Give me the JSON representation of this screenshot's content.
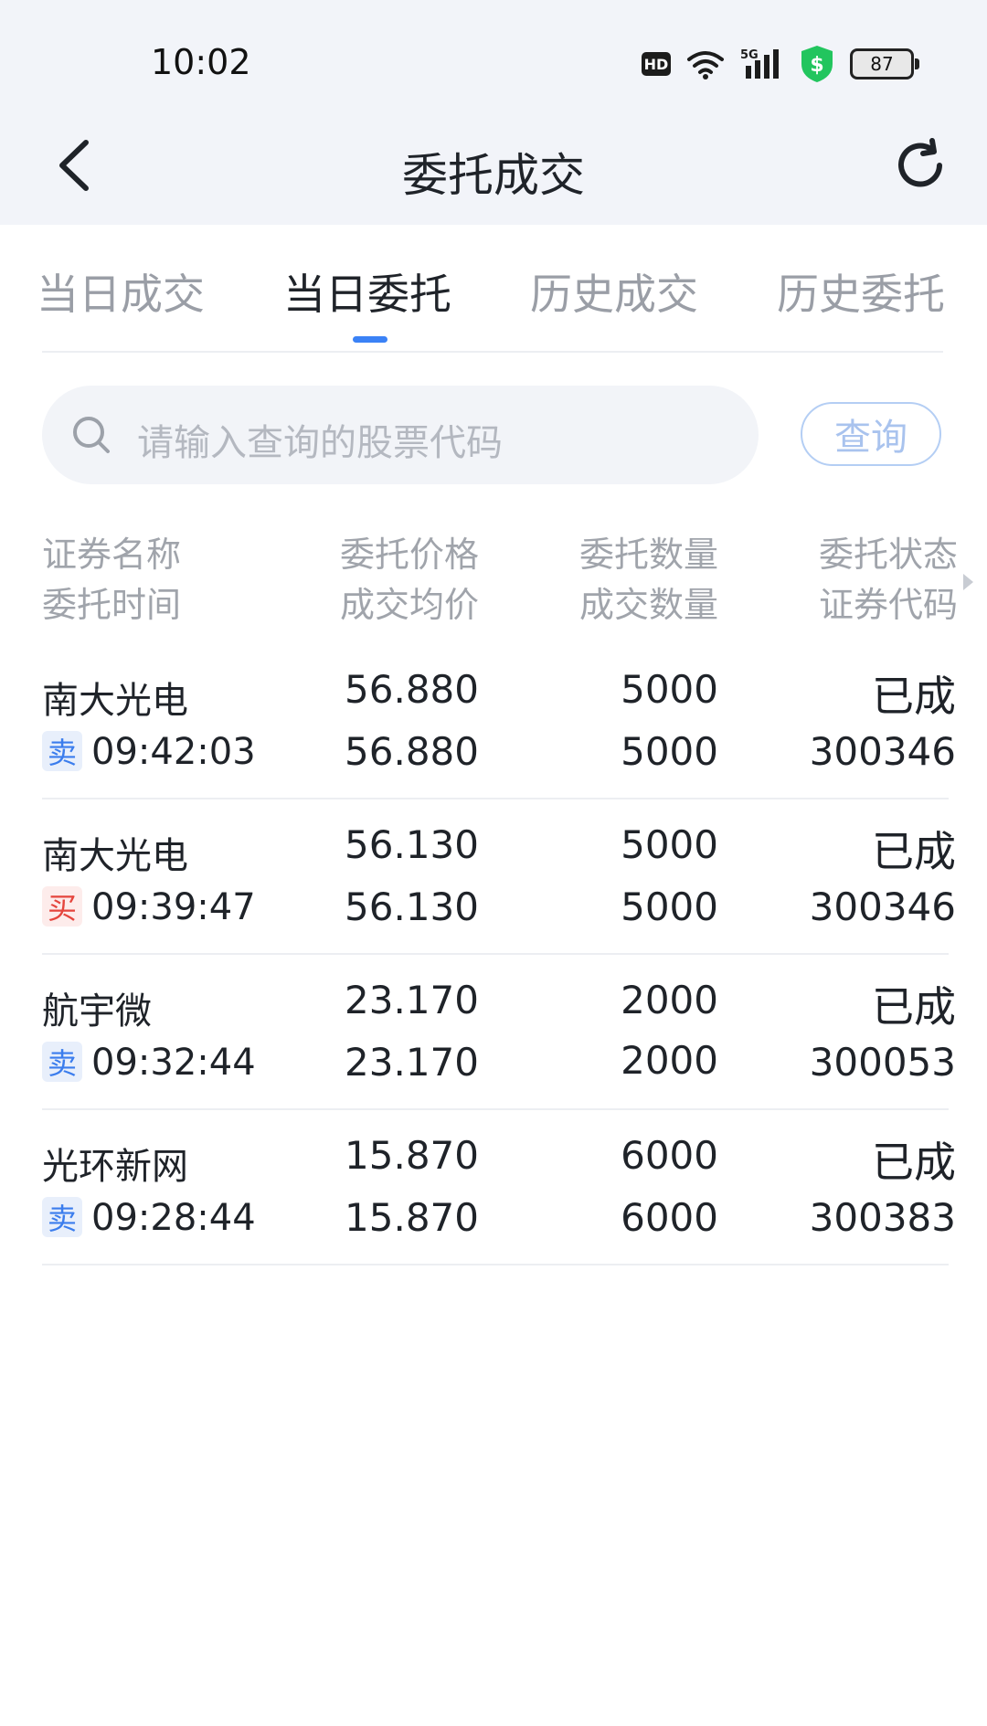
{
  "status_bar": {
    "time": "10:02",
    "hd": "HD",
    "network": "5G",
    "battery": "87"
  },
  "header": {
    "title": "委托成交",
    "back_icon": "chevron-left-icon",
    "refresh_icon": "refresh-icon"
  },
  "tabs": [
    {
      "label": "当日成交",
      "active": false
    },
    {
      "label": "当日委托",
      "active": true
    },
    {
      "label": "历史成交",
      "active": false
    },
    {
      "label": "历史委托",
      "active": false
    }
  ],
  "search": {
    "placeholder": "请输入查询的股票代码",
    "button": "查询"
  },
  "columns": {
    "col1_top": "证券名称",
    "col1_bottom": "委托时间",
    "col2_top": "委托价格",
    "col2_bottom": "成交均价",
    "col3_top": "委托数量",
    "col3_bottom": "成交数量",
    "col4_top": "委托状态",
    "col4_bottom": "证券代码"
  },
  "orders": [
    {
      "name": "南大光电",
      "side": "卖",
      "side_type": "sell",
      "time": "09:42:03",
      "price": "56.880",
      "avg_price": "56.880",
      "qty": "5000",
      "filled_qty": "5000",
      "status": "已成",
      "code": "300346"
    },
    {
      "name": "南大光电",
      "side": "买",
      "side_type": "buy",
      "time": "09:39:47",
      "price": "56.130",
      "avg_price": "56.130",
      "qty": "5000",
      "filled_qty": "5000",
      "status": "已成",
      "code": "300346"
    },
    {
      "name": "航宇微",
      "side": "卖",
      "side_type": "sell",
      "time": "09:32:44",
      "price": "23.170",
      "avg_price": "23.170",
      "qty": "2000",
      "filled_qty": "2000",
      "status": "已成",
      "code": "300053"
    },
    {
      "name": "光环新网",
      "side": "卖",
      "side_type": "sell",
      "time": "09:28:44",
      "price": "15.870",
      "avg_price": "15.870",
      "qty": "6000",
      "filled_qty": "6000",
      "status": "已成",
      "code": "300383"
    }
  ],
  "colors": {
    "accent": "#3b82f6",
    "sell": "#3b7ded",
    "buy": "#e5453d"
  }
}
